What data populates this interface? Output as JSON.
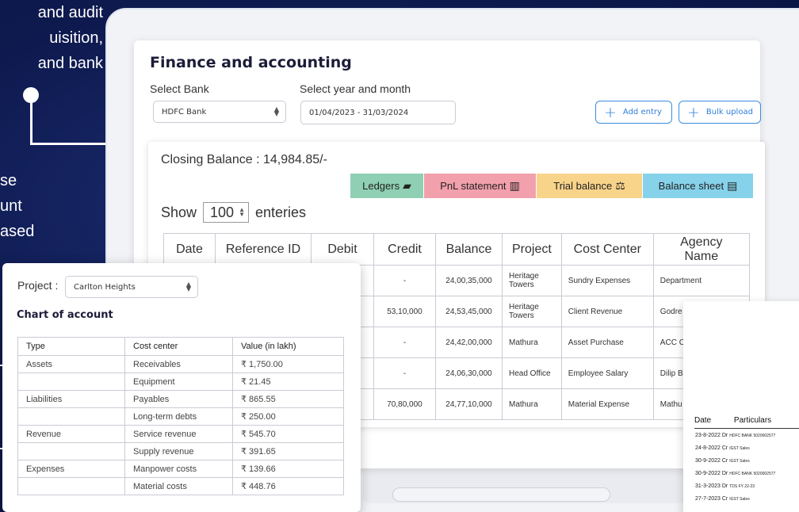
{
  "background": {
    "top_lines": [
      "and audit",
      "uisition,",
      "and bank"
    ],
    "mid_lines": [
      "se",
      "unt",
      "ased"
    ]
  },
  "finance": {
    "title": "Finance and accounting",
    "bank_label": "Select Bank",
    "bank_value": "HDFC Bank",
    "period_label": "Select year and month",
    "period_value": "01/04/2023 - 31/03/2024",
    "add_entry": "Add entry",
    "bulk_upload": "Bulk upload",
    "closing_balance": "Closing Balance : 14,984.85/-",
    "tabs": [
      {
        "label": "Ledgers",
        "icon": "ledger-icon",
        "color": "#8fcfb3"
      },
      {
        "label": "PnL statement",
        "icon": "pnl-chart-icon",
        "color": "#f2a0ac"
      },
      {
        "label": "Trial balance",
        "icon": "scales-icon",
        "color": "#f8d38a"
      },
      {
        "label": "Balance sheet",
        "icon": "balance-sheet-icon",
        "color": "#86d2ea"
      }
    ],
    "show_label": "Show",
    "show_value": "100",
    "entries_label": "enteries",
    "columns": [
      "Date",
      "Reference ID",
      "Debit",
      "Credit",
      "Balance",
      "Project",
      "Cost Center",
      "Agency Name"
    ],
    "rows": [
      {
        "credit": "-",
        "balance": "24,00,35,000",
        "project": "Heritage Towers",
        "cost_center": "Sundry Expenses",
        "agency": "Department"
      },
      {
        "credit": "53,10,000",
        "balance": "24,53,45,000",
        "project": "Heritage Towers",
        "cost_center": "Client Revenue",
        "agency": "Godre"
      },
      {
        "credit": "-",
        "balance": "24,42,00,000",
        "project": "Mathura",
        "cost_center": "Asset Purchase",
        "agency": "ACC C"
      },
      {
        "credit": "-",
        "balance": "24,06,30,000",
        "project": "Head Office",
        "cost_center": "Employee Salary",
        "agency": "Dilip B"
      },
      {
        "credit": "70,80,000",
        "balance": "24,77,10,000",
        "project": "Mathura",
        "cost_center": "Material Expense",
        "agency": "Mathu"
      }
    ]
  },
  "chart_of_account": {
    "project_label": "Project :",
    "project_value": "Carlton Heights",
    "title": "Chart of account",
    "columns": [
      "Type",
      "Cost center",
      "Value (in lakh)"
    ],
    "rows": [
      {
        "type": "Assets",
        "center": "Receivables",
        "value": "₹ 1,750.00"
      },
      {
        "type": "",
        "center": "Equipment",
        "value": "₹ 21.45"
      },
      {
        "type": "Liabilities",
        "center": "Payables",
        "value": "₹ 865.55"
      },
      {
        "type": "",
        "center": "Long-term debts",
        "value": "₹ 250.00"
      },
      {
        "type": "Revenue",
        "center": "Service revenue",
        "value": "₹ 545.70"
      },
      {
        "type": "",
        "center": "Supply revenue",
        "value": "₹ 391.65"
      },
      {
        "type": "Expenses",
        "center": "Manpower costs",
        "value": "₹ 139.66"
      },
      {
        "type": "",
        "center": "Material costs",
        "value": "₹ 448.76"
      }
    ]
  },
  "receipts": {
    "date_header": "Date",
    "particulars_header": "Particulars",
    "rows": [
      {
        "date": "23-8-2022",
        "type": "Dr",
        "particular": "HDFC BANK 5020002577"
      },
      {
        "date": "24-8-2022",
        "type": "Cr",
        "particular": "IGST Sales"
      },
      {
        "date": "30-9-2022",
        "type": "Cr",
        "particular": "IGST Sales"
      },
      {
        "date": "30-9-2022",
        "type": "Dr",
        "particular": "HDFC BANK 5020002577"
      },
      {
        "date": "31-3-2023",
        "type": "Dr",
        "particular": "TDS FY 22-23"
      },
      {
        "date": "27-7-2023",
        "type": "Cr",
        "particular": "IGST Sales"
      }
    ]
  }
}
